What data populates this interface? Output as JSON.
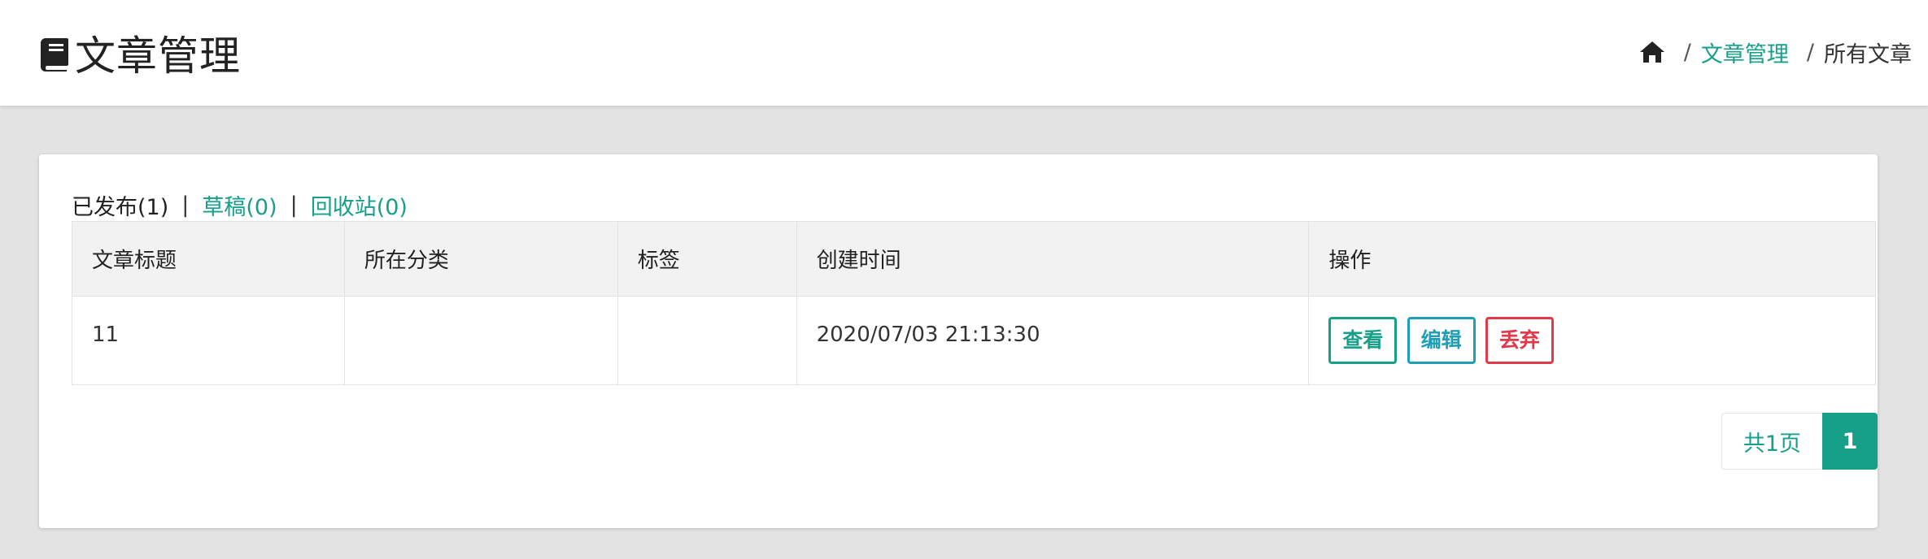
{
  "header": {
    "title": "文章管理",
    "title_icon": "book-icon",
    "breadcrumb": {
      "home_icon": "home-icon",
      "items": [
        {
          "label": "文章管理",
          "is_link": true
        },
        {
          "label": "所有文章",
          "is_link": false
        }
      ]
    }
  },
  "filters": {
    "published": "已发布(1)",
    "drafts": "草稿(0)",
    "trash": "回收站(0)"
  },
  "table": {
    "columns": [
      "文章标题",
      "所在分类",
      "标签",
      "创建时间",
      "操作"
    ],
    "rows": [
      {
        "title": "11",
        "category": "",
        "tags": "",
        "created_at": "2020/07/03 21:13:30",
        "actions": {
          "view": "查看",
          "edit": "编辑",
          "discard": "丢弃"
        }
      }
    ]
  },
  "pagination": {
    "total_pages_label": "共1页",
    "current_page": "1"
  },
  "colors": {
    "accent": "#16a08a",
    "edit": "#1e9fb5",
    "danger": "#e0394a",
    "page_bg": "#e3e3e3"
  }
}
